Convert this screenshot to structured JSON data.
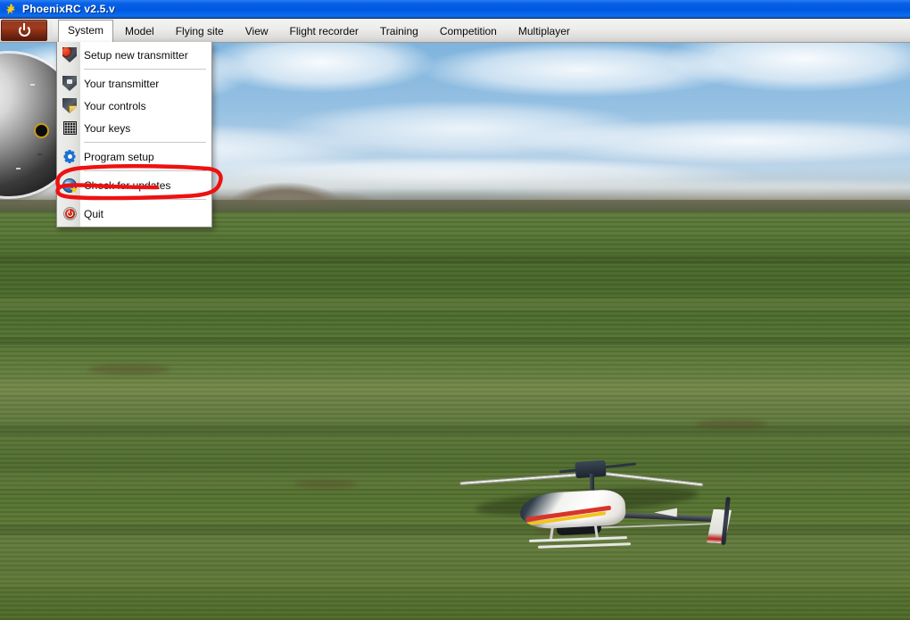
{
  "window": {
    "title": "PhoenixRC v2.5.v",
    "icon": "phoenix-bird-icon",
    "titlebar_color": "#0a62e8"
  },
  "toolbar": {
    "power_button_label": "",
    "power_button_icon": "power-icon",
    "power_button_color": "#a23a1d"
  },
  "menubar": {
    "items": [
      {
        "label": "System",
        "active": true
      },
      {
        "label": "Model",
        "active": false
      },
      {
        "label": "Flying site",
        "active": false
      },
      {
        "label": "View",
        "active": false
      },
      {
        "label": "Flight recorder",
        "active": false
      },
      {
        "label": "Training",
        "active": false
      },
      {
        "label": "Competition",
        "active": false
      },
      {
        "label": "Multiplayer",
        "active": false
      }
    ]
  },
  "system_menu": {
    "open": true,
    "items": [
      {
        "label": "Setup new transmitter",
        "icon": "shield-plus-icon",
        "separator_after": true
      },
      {
        "label": "Your transmitter",
        "icon": "shield-transmitter-icon",
        "separator_after": false
      },
      {
        "label": "Your controls",
        "icon": "shield-lock-icon",
        "separator_after": false
      },
      {
        "label": "Your keys",
        "icon": "keypad-icon",
        "separator_after": true
      },
      {
        "label": "Program setup",
        "icon": "gear-icon",
        "separator_after": true
      },
      {
        "label": "Check for updates",
        "icon": "globe-star-icon",
        "separator_after": true
      },
      {
        "label": "Quit",
        "icon": "power-off-icon",
        "separator_after": false
      }
    ]
  },
  "annotation": {
    "shape": "hand-drawn-ellipse",
    "color": "#ee1111",
    "targets": "Check for updates"
  },
  "scene": {
    "description": "RC flight simulator — helicopter parked on a green grass field",
    "sky_color": "#9dc4e4",
    "grass_color": "#4e6a2c",
    "treeline_color": "#7d7565",
    "aircraft": "rc-helicopter",
    "gauge": "circular-dial"
  }
}
